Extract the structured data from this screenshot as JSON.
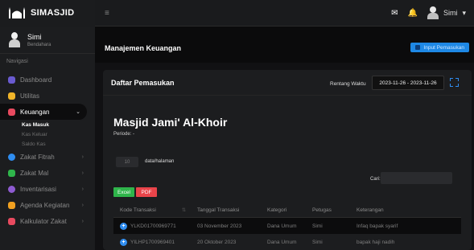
{
  "brand": {
    "name": "SIMASJID"
  },
  "topbar": {
    "user_name": "Simi",
    "user_chevron": "▾"
  },
  "sidebar": {
    "profile_name": "Simi",
    "profile_role": "Bendahara",
    "section_label": "Navigasi",
    "items": [
      {
        "label": "Dashboard",
        "color": "#6a5bd1"
      },
      {
        "label": "Utilitas",
        "color": "#f0b429"
      },
      {
        "label": "Keuangan",
        "color": "#e84a5f",
        "active": true
      },
      {
        "label": "Zakat Fitrah",
        "color": "#2f8df0"
      },
      {
        "label": "Zakat Mal",
        "color": "#2fb54b"
      },
      {
        "label": "Inventarisasi",
        "color": "#8e5bd1"
      },
      {
        "label": "Agenda Kegiatan",
        "color": "#f0a020"
      },
      {
        "label": "Kalkulator Zakat",
        "color": "#e84a5f"
      }
    ],
    "sub_items": [
      "Kas Masuk",
      "Kas Keluar",
      "Saldo Kas"
    ]
  },
  "header": {
    "title": "Manajemen Keuangan",
    "input_button": "Input Pemasukan"
  },
  "card": {
    "title": "Daftar Pemasukan",
    "range_label": "Rentang Waktu",
    "range_value": "2023-11-26 - 2023-11-26",
    "org_name": "Masjid Jami' Al-Khoir",
    "periode": "Periode: -",
    "perpage_value": "10",
    "perpage_label": "data/halaman",
    "search_label": "Cari:",
    "excel": "Excel",
    "pdf": "PDF"
  },
  "table": {
    "headers": [
      "Kode Transaksi",
      "Tanggal Transaksi",
      "Kategori",
      "Petugas",
      "Keterangan"
    ],
    "rows": [
      [
        "YLKD01700969771",
        "03 November 2023",
        "Dana Umum",
        "Simi",
        "Infaq bapak syarif"
      ],
      [
        "YILHP1700969401",
        "20 Oktober 2023",
        "Dana Umum",
        "Simi",
        "bapak haji nadih"
      ]
    ]
  },
  "colors": {
    "accent": "#1e88e5",
    "excel": "#2fb54b",
    "pdf": "#e9444a"
  }
}
